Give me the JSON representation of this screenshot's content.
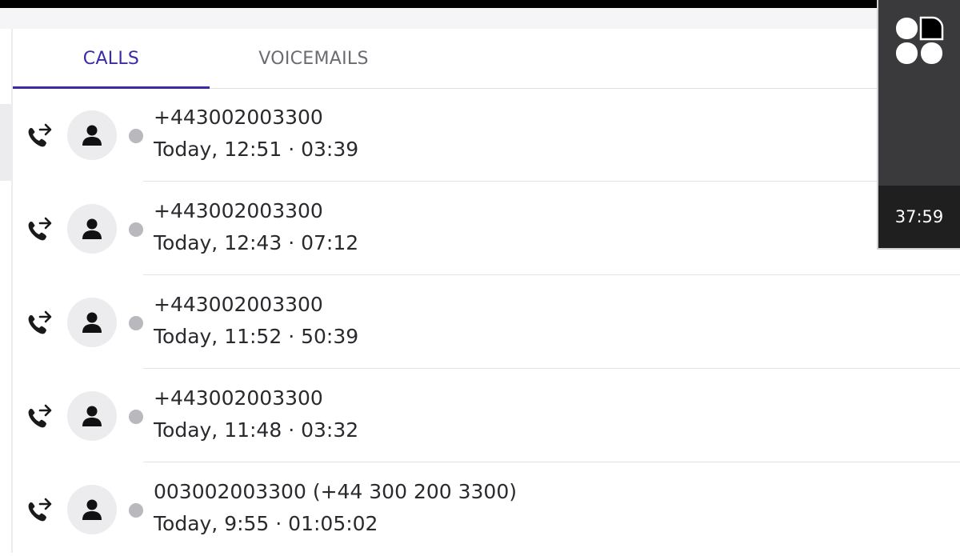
{
  "tabs": [
    {
      "label": "CALLS",
      "active": true
    },
    {
      "label": "VOICEMAILS",
      "active": false
    }
  ],
  "calls": [
    {
      "number": "+443002003300",
      "meta": "Today, 12:51 · 03:39",
      "icon": "outgoing-call-icon"
    },
    {
      "number": "+443002003300",
      "meta": "Today, 12:43 · 07:12",
      "icon": "outgoing-call-icon"
    },
    {
      "number": "+443002003300",
      "meta": "Today, 11:52 · 50:39",
      "icon": "outgoing-call-icon"
    },
    {
      "number": "+443002003300",
      "meta": "Today, 11:48 · 03:32",
      "icon": "outgoing-call-icon"
    },
    {
      "number": "003002003300 (+44 300 200 3300)",
      "meta": "Today, 9:55 · 01:05:02",
      "icon": "outgoing-call-icon"
    }
  ],
  "overlay": {
    "timer": "37:59",
    "logo_icon": "app-logo-icon"
  },
  "colors": {
    "accent": "#3a2aa6",
    "status_dot": "#b8b8bd",
    "overlay_bg": "#3a3a3c",
    "timer_bg": "#1f1f20"
  }
}
